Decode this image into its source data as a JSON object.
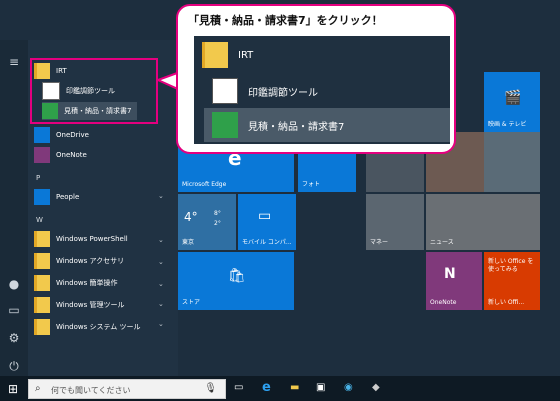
{
  "callout": {
    "title": "「見積・納品・請求書7」をクリック！",
    "rows": [
      "IRT",
      "印鑑調節ツール",
      "見積・納品・請求書7"
    ]
  },
  "applist": {
    "group_irt": "IRT",
    "irt_items": [
      "印鑑調節ツール",
      "見積・納品・請求書7"
    ],
    "onedrive": "OneDrive",
    "onenote": "OneNote",
    "letter_p": "P",
    "people": "People",
    "letter_w": "W",
    "w_items": [
      "Windows PowerShell",
      "Windows アクセサリ",
      "Windows 簡単操作",
      "Windows 管理ツール",
      "Windows システム ツール"
    ]
  },
  "tiles": {
    "movies": "映画 & テレビ",
    "edge": "Microsoft Edge",
    "photos": "フォト",
    "weather_temp": "4°",
    "weather_high": "8°",
    "weather_low": "2°",
    "weather_city": "東京",
    "mobile": "モバイル コンパ...",
    "money": "マネー",
    "news": "ニュース",
    "store": "ストア",
    "onenote": "OneNote",
    "office_promo": "新しい Office を使ってみる",
    "office_promo2": "新しい Offi..."
  },
  "taskbar": {
    "search_placeholder": "何でも聞いてください"
  },
  "colors": {
    "accent": "#e4007f",
    "tile_blue": "#0a78d7",
    "onenote_purple": "#80397b",
    "office_red": "#d83b01"
  }
}
